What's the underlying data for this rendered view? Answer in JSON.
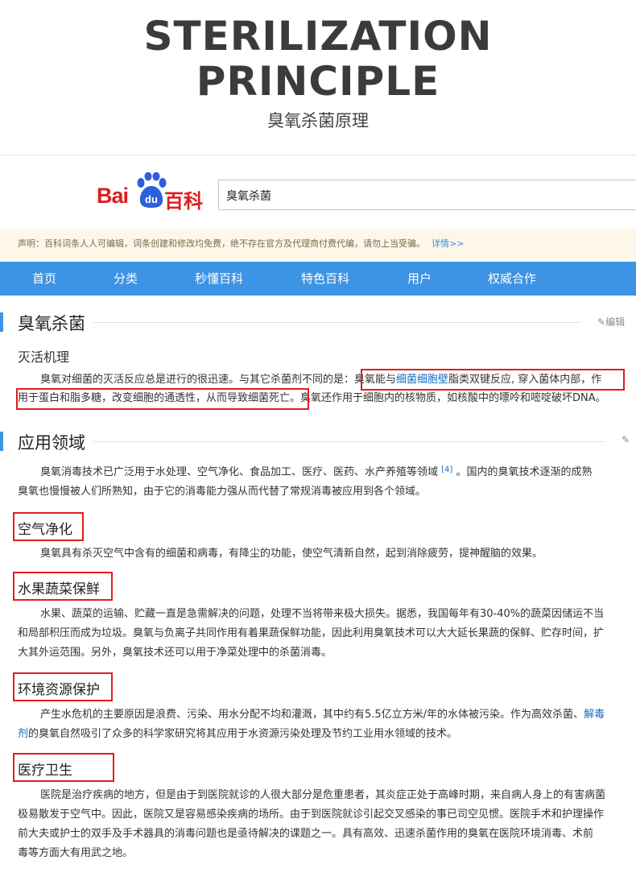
{
  "hero": {
    "title_line1": "STERILIZATION",
    "title_line2": "PRINCIPLE",
    "subtitle": "臭氧杀菌原理"
  },
  "logo": {
    "text_bai": "Bai",
    "text_du": "du",
    "text_baike": "百科"
  },
  "search": {
    "value": "臭氧杀菌"
  },
  "notice": {
    "text": "声明：百科词条人人可编辑，词条创建和修改均免费，绝不存在官方及代理商付费代编，请勿上当受骗。",
    "more": "详情>>"
  },
  "nav": {
    "items": [
      "首页",
      "分类",
      "秒懂百科",
      "特色百科",
      "用户",
      "权威合作"
    ]
  },
  "section1": {
    "heading": "臭氧杀菌",
    "edit": "编辑",
    "subheading": "灭活机理",
    "p1_a": "臭氧对细菌的灭活反应总是进行的很迅速。与其它杀菌剂不同的是：",
    "p1_b": "臭氧能与",
    "p1_link": "细菌细胞壁",
    "p1_c": "脂类双键反应, 穿入菌体内部，作",
    "p2_a": "用于蛋白和脂多糖，改变细胞的通透性，从而导致细菌死亡。",
    "p2_b": "臭氧还作用于细胞内的核物质，如核酸中的嘌呤和嘧啶破坏DNA。"
  },
  "section2": {
    "heading": "应用领域",
    "intro_1a": "臭氧消毒技术已广泛用于水处理、空气净化、食品加工、医疗、医药、水产养殖等领域",
    "intro_ref": "[4]",
    "intro_1b": "。国内的臭氧技术逐渐的成熟",
    "intro_2": "臭氧也慢慢被人们所熟知，由于它的消毒能力强从而代替了常规消毒被应用到各个领域。",
    "air_title": "空气净化",
    "air_text": "臭氧具有杀灭空气中含有的细菌和病毒，有降尘的功能，使空气清新自然，起到消除疲劳，提神醒脑的效果。",
    "fruit_title": "水果蔬菜保鲜",
    "fruit_1": "水果、蔬菜的运输、贮藏一直是急需解决的问题，处理不当将带来极大损失。据悉，我国每年有30-40%的蔬菜因储运不当",
    "fruit_2": "和局部积压而成为垃圾。臭氧与负离子共同作用有着果蔬保鲜功能，因此利用臭氧技术可以大大延长果蔬的保鲜、贮存时间，扩",
    "fruit_3": "大其外运范围。另外，臭氧技术还可以用于净菜处理中的杀菌消毒。",
    "env_title": "环境资源保护",
    "env_1a": "产生水危机的主要原因是浪费、污染、用水分配不均和灌溉，其中约有5.5亿立方米/年的水体被污染。作为高效杀菌、",
    "env_1link": "解毒",
    "env_2link": "剂",
    "env_2": "的臭氧自然吸引了众多的科学家研究将其应用于水资源污染处理及节约工业用水领域的技术。",
    "med_title": "医疗卫生",
    "med_1": "医院是治疗疾病的地方，但是由于到医院就诊的人很大部分是危重患者，其炎症正处于高峰时期，来自病人身上的有害病菌",
    "med_2": "极易散发于空气中。因此，医院又是容易感染疾病的场所。由于到医院就诊引起交叉感染的事已司空见惯。医院手术和护理操作",
    "med_3": "前大夫或护士的双手及手术器具的消毒问题也是亟待解决的课题之一。具有高效、迅速杀菌作用的臭氧在医院环境消毒、术前",
    "med_4": "毒等方面大有用武之地。"
  }
}
